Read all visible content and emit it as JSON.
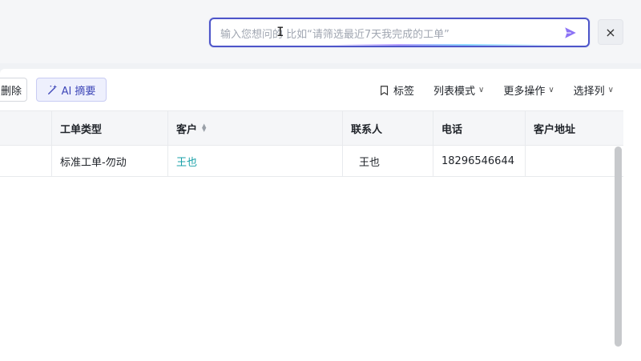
{
  "ai_search": {
    "placeholder": "输入您想问的  比如“请筛选最近7天我完成的工单”",
    "cursor_glyph": "I"
  },
  "close_label": "×",
  "toolbar": {
    "delete_label": "删除",
    "ai_summary_label": "AI 摘要",
    "tags_label": "标签",
    "list_mode_label": "列表模式",
    "more_actions_label": "更多操作",
    "select_columns_label": "选择列",
    "chevron": "∨"
  },
  "table": {
    "headers": [
      "工单类型",
      "客户",
      "联系人",
      "电话",
      "客户地址"
    ],
    "rows": [
      [
        "标准工单-勿动",
        "王也",
        "王也",
        "18296546644",
        ""
      ]
    ]
  },
  "colors": {
    "accent": "#4d55c9",
    "link": "#18a0a8",
    "send_icon": "#8c73f5"
  }
}
